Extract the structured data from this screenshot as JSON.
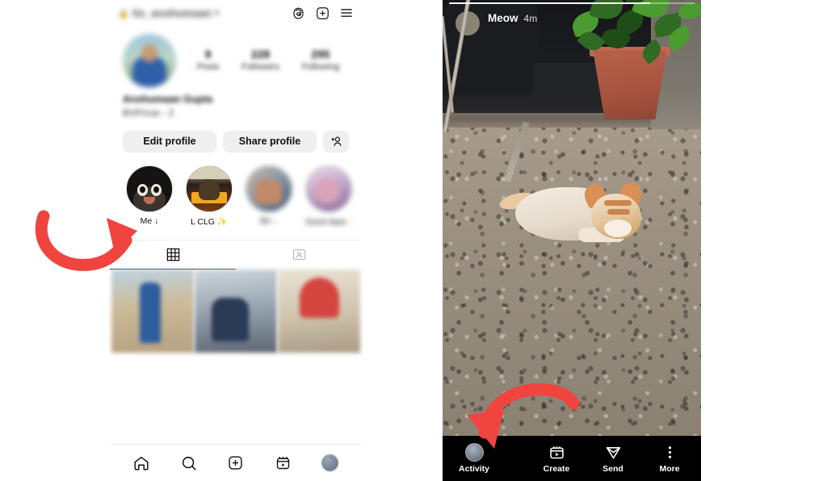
{
  "profile": {
    "topbar": {
      "lock_icon": "lock-icon",
      "username": "its_anshumaan",
      "chevron_icon": "chevron-down-icon",
      "threads_icon": "threads-icon",
      "create_icon": "plus-box-icon",
      "menu_icon": "hamburger-menu-icon"
    },
    "avatar_name": "profile-avatar",
    "stats": [
      {
        "num": "9",
        "label": "Posts"
      },
      {
        "num": "228",
        "label": "Followers"
      },
      {
        "num": "295",
        "label": "Following"
      }
    ],
    "bio": {
      "name": "Anshumaan Gupta",
      "line": "BVP/cse - 2"
    },
    "buttons": {
      "edit_profile": "Edit profile",
      "share_profile": "Share profile",
      "add_person_icon": "add-person-icon"
    },
    "highlights": [
      {
        "label": "Me ↓",
        "art": "monkey",
        "blurred": false
      },
      {
        "label": "L CLG ✨",
        "art": "clg",
        "blurred": false
      },
      {
        "label": "Bir ↓",
        "art": "b1",
        "blurred": true
      },
      {
        "label": "Good days ✨",
        "art": "b2",
        "blurred": true
      }
    ],
    "tabs": [
      {
        "name": "grid",
        "icon": "grid-icon",
        "active": true
      },
      {
        "name": "tagged",
        "icon": "tagged-person-icon",
        "active": false
      }
    ],
    "grid_cells": [
      "post-1",
      "post-2",
      "post-3"
    ],
    "bottom_nav": [
      {
        "name": "home",
        "icon": "home-icon"
      },
      {
        "name": "search",
        "icon": "search-icon"
      },
      {
        "name": "create",
        "icon": "plus-box-icon"
      },
      {
        "name": "reels",
        "icon": "reels-icon"
      },
      {
        "name": "profile",
        "icon": "profile-avatar-icon"
      }
    ]
  },
  "story": {
    "progress_percent": 82,
    "username": "Meow",
    "timestamp": "4m",
    "scene": "cat-lying-on-concrete-with-potted-plant",
    "bottom_bar": [
      {
        "name": "activity",
        "label": "Activity",
        "icon": "activity-avatar-icon"
      },
      {
        "name": "create",
        "label": "Create",
        "icon": "reels-create-icon"
      },
      {
        "name": "send",
        "label": "Send",
        "icon": "paper-plane-icon"
      },
      {
        "name": "more",
        "label": "More",
        "icon": "three-dots-icon"
      }
    ]
  },
  "annotations": {
    "arrow_left": "red-curved-arrow-pointing-to-highlight",
    "arrow_right": "red-curved-arrow-pointing-to-activity",
    "arrow_color": "#f0443e"
  }
}
